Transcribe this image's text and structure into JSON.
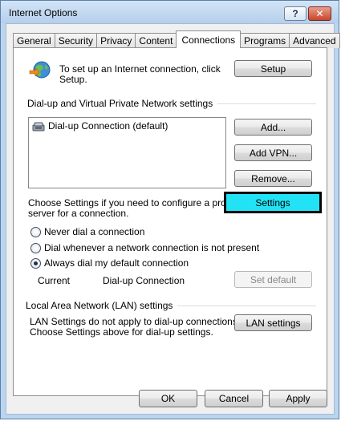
{
  "window": {
    "title": "Internet Options"
  },
  "titlebar": {
    "help_glyph": "?",
    "close_glyph": "✕"
  },
  "tabs": [
    {
      "label": "General",
      "active": false
    },
    {
      "label": "Security",
      "active": false
    },
    {
      "label": "Privacy",
      "active": false
    },
    {
      "label": "Content",
      "active": false
    },
    {
      "label": "Connections",
      "active": true
    },
    {
      "label": "Programs",
      "active": false
    },
    {
      "label": "Advanced",
      "active": false
    }
  ],
  "setup": {
    "text_line1": "To set up an Internet connection, click",
    "text_line2": "Setup.",
    "button": "Setup"
  },
  "dialup": {
    "section_title": "Dial-up and Virtual Private Network settings",
    "list_items": [
      "Dial-up Connection (default)"
    ],
    "add_button": "Add...",
    "add_vpn_button": "Add VPN...",
    "remove_button": "Remove...",
    "proxy_text_line1": "Choose Settings if you need to configure a proxy",
    "proxy_text_line2": "server for a connection.",
    "settings_button": "Settings",
    "radio_options": [
      {
        "label": "Never dial a connection",
        "selected": false
      },
      {
        "label": "Dial whenever a network connection is not present",
        "selected": false
      },
      {
        "label": "Always dial my default connection",
        "selected": true
      }
    ],
    "current_label": "Current",
    "current_value": "Dial-up Connection",
    "set_default_button": "Set default"
  },
  "lan": {
    "section_title": "Local Area Network (LAN) settings",
    "text_line1": "LAN Settings do not apply to dial-up connections.",
    "text_line2": "Choose Settings above for dial-up settings.",
    "button": "LAN settings"
  },
  "footer": {
    "ok": "OK",
    "cancel": "Cancel",
    "apply": "Apply"
  },
  "colors": {
    "highlight": "#22e3f5",
    "window_frame": "#bcd5ef"
  },
  "icons": [
    "globe-network-icon",
    "dialup-connection-icon"
  ]
}
